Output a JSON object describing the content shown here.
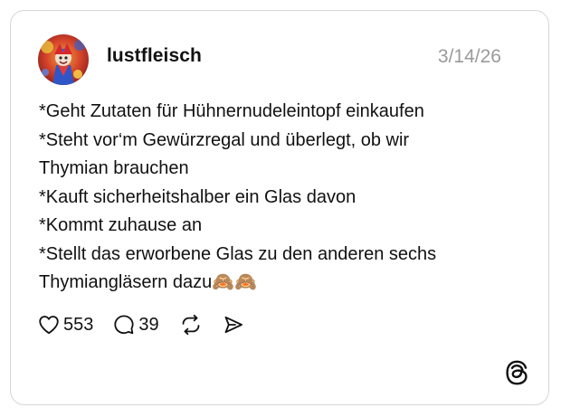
{
  "post": {
    "username": "lustfleisch",
    "date": "3/14/26",
    "lines": [
      "*Geht Zutaten für Hühnernudeleintopf einkaufen",
      "*Steht vor‘m Gewürzregal und überlegt, ob wir",
      "Thymian brauchen",
      "*Kauft sicherheitshalber ein Glas davon",
      "*Kommt zuhause an",
      "*Stellt das erworbene Glas zu den anderen sechs",
      "Thymiangläsern dazu🙈🙈"
    ]
  },
  "actions": {
    "like_count": "553",
    "reply_count": "39"
  },
  "icons": {
    "like": "heart-icon",
    "reply": "speech-bubble-icon",
    "repost": "repost-icon",
    "share": "send-icon",
    "brand": "threads-logo-icon"
  },
  "colors": {
    "text": "#111111",
    "muted": "#9a9a9a",
    "border": "#d6d6d6",
    "background": "#ffffff"
  }
}
